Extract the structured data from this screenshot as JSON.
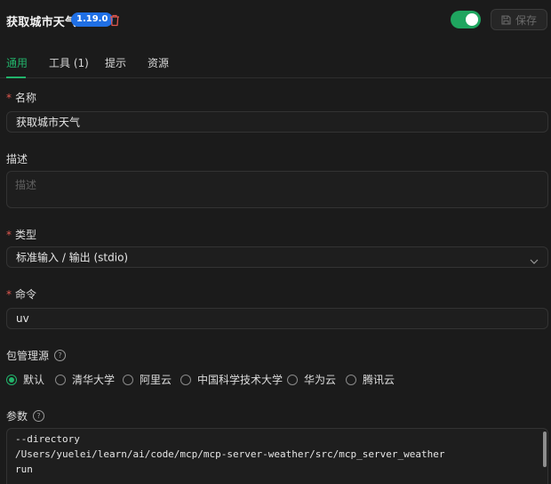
{
  "header": {
    "title": "获取城市天气",
    "version": "1.19.0",
    "trash_icon": "trash-icon",
    "toggle_on": true,
    "save_label": "保存",
    "save_icon": "save-icon"
  },
  "colors": {
    "accent": "#22b46b",
    "badge": "#1f6fe5",
    "danger": "#e0574f",
    "background": "#1b1b1b"
  },
  "tabs": [
    {
      "label": "通用",
      "active": true
    },
    {
      "label": "工具 (1)",
      "active": false
    },
    {
      "label": "提示",
      "active": false
    },
    {
      "label": "资源",
      "active": false
    }
  ],
  "form": {
    "name": {
      "label": "名称",
      "required": "*",
      "value": "获取城市天气"
    },
    "description": {
      "label": "描述",
      "placeholder": "描述"
    },
    "type": {
      "label": "类型",
      "required": "*",
      "value": "标准输入 / 输出 (stdio)"
    },
    "command": {
      "label": "命令",
      "required": "*",
      "value": "uv"
    },
    "registry": {
      "label": "包管理源",
      "help_icon": "?",
      "options": [
        {
          "label": "默认",
          "selected": true
        },
        {
          "label": "清华大学",
          "selected": false
        },
        {
          "label": "阿里云",
          "selected": false
        },
        {
          "label": "中国科学技术大学",
          "selected": false
        },
        {
          "label": "华为云",
          "selected": false
        },
        {
          "label": "腾讯云",
          "selected": false
        }
      ]
    },
    "args": {
      "label": "参数",
      "help_icon": "?",
      "lines": [
        "--directory",
        "/Users/yuelei/learn/ai/code/mcp/mcp-server-weather/src/mcp_server_weather",
        "run"
      ]
    }
  }
}
